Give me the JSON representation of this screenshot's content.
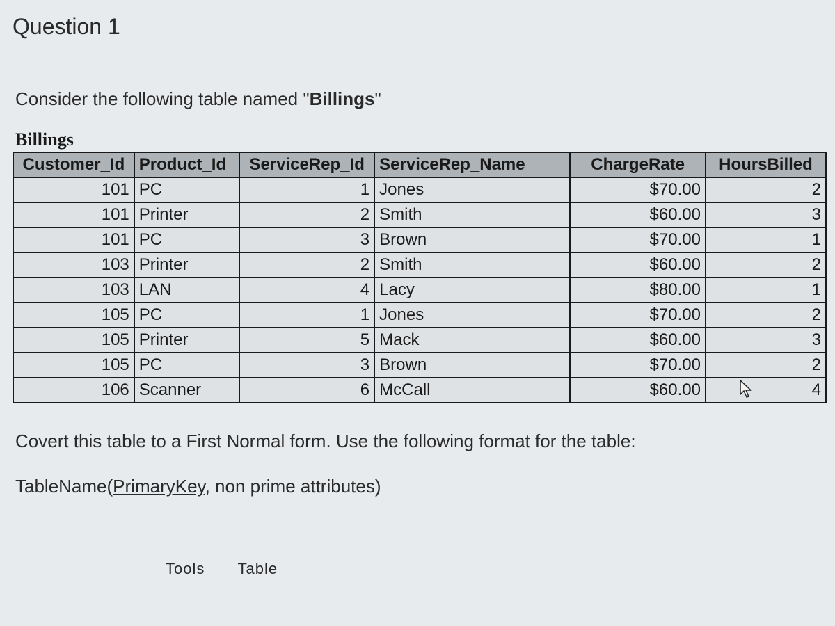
{
  "title": "Question 1",
  "intro_prefix": "Consider the following table named \"",
  "intro_bold": "Billings",
  "intro_suffix": "\"",
  "table_title": "Billings",
  "columns": [
    "Customer_Id",
    "Product_Id",
    "ServiceRep_Id",
    "ServiceRep_Name",
    "ChargeRate",
    "HoursBilled"
  ],
  "rows": [
    {
      "customer_id": "101",
      "product_id": "PC",
      "rep_id": "1",
      "rep_name": "Jones",
      "rate": "$70.00",
      "hours": "2"
    },
    {
      "customer_id": "101",
      "product_id": "Printer",
      "rep_id": "2",
      "rep_name": "Smith",
      "rate": "$60.00",
      "hours": "3"
    },
    {
      "customer_id": "101",
      "product_id": "PC",
      "rep_id": "3",
      "rep_name": "Brown",
      "rate": "$70.00",
      "hours": "1"
    },
    {
      "customer_id": "103",
      "product_id": "Printer",
      "rep_id": "2",
      "rep_name": "Smith",
      "rate": "$60.00",
      "hours": "2"
    },
    {
      "customer_id": "103",
      "product_id": "LAN",
      "rep_id": "4",
      "rep_name": "Lacy",
      "rate": "$80.00",
      "hours": "1"
    },
    {
      "customer_id": "105",
      "product_id": "PC",
      "rep_id": "1",
      "rep_name": "Jones",
      "rate": "$70.00",
      "hours": "2"
    },
    {
      "customer_id": "105",
      "product_id": "Printer",
      "rep_id": "5",
      "rep_name": "Mack",
      "rate": "$60.00",
      "hours": "3"
    },
    {
      "customer_id": "105",
      "product_id": "PC",
      "rep_id": "3",
      "rep_name": "Brown",
      "rate": "$70.00",
      "hours": "2"
    },
    {
      "customer_id": "106",
      "product_id": "Scanner",
      "rep_id": "6",
      "rep_name": "McCall",
      "rate": "$60.00",
      "hours": "4"
    }
  ],
  "task": "Covert this table to a First Normal form.  Use the following format for the table:",
  "format_prefix": "TableName(",
  "format_pk": "PrimaryKey",
  "format_suffix": ", non prime attributes)",
  "bottom_tabs": [
    "Tools",
    "Table"
  ]
}
